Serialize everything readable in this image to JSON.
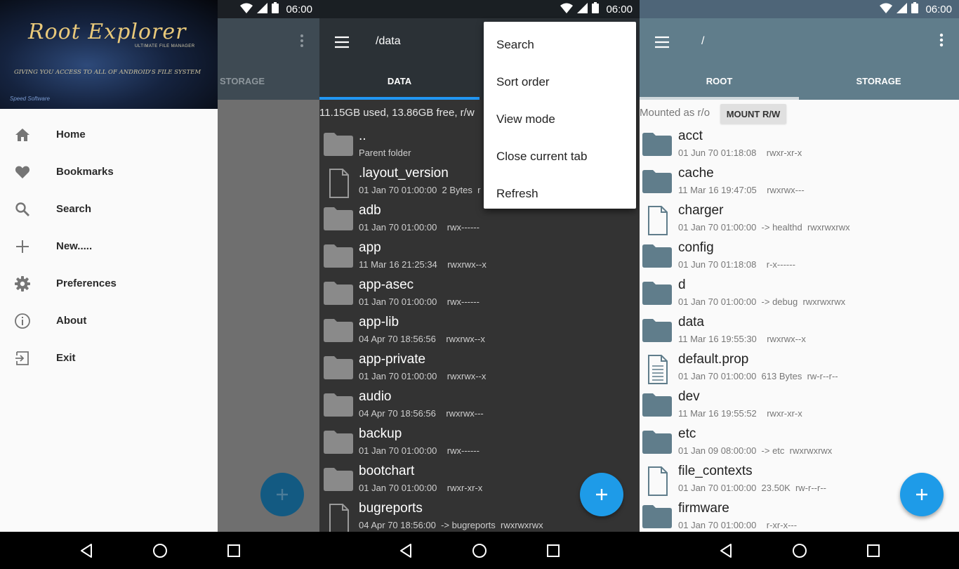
{
  "statusbar": {
    "time": "06:00"
  },
  "drawer": {
    "header": {
      "title": "Root Explorer",
      "subtitle": "ULTIMATE FILE MANAGER",
      "tagline": "GIVING YOU ACCESS TO ALL OF ANDROID'S FILE SYSTEM",
      "brand": "Speed Software"
    },
    "items": [
      {
        "label": "Home",
        "icon": "home-icon"
      },
      {
        "label": "Bookmarks",
        "icon": "heart-icon"
      },
      {
        "label": "Search",
        "icon": "search-icon"
      },
      {
        "label": "New.....",
        "icon": "plus-icon"
      },
      {
        "label": "Preferences",
        "icon": "gear-icon"
      },
      {
        "label": "About",
        "icon": "info-icon"
      },
      {
        "label": "Exit",
        "icon": "exit-icon"
      }
    ],
    "background_tab": "STORAGE"
  },
  "data_screen": {
    "path": "/data",
    "tab": "DATA",
    "info": "11.15GB used, 13.86GB free, r/w",
    "files": [
      {
        "name": "..",
        "meta": "Parent folder",
        "type": "folder"
      },
      {
        "name": ".layout_version",
        "meta": "01 Jan 70 01:00:00  2 Bytes  r",
        "type": "file"
      },
      {
        "name": "adb",
        "meta": "01 Jan 70 01:00:00    rwx------",
        "type": "folder"
      },
      {
        "name": "app",
        "meta": "11 Mar 16 21:25:34    rwxrwx--x",
        "type": "folder"
      },
      {
        "name": "app-asec",
        "meta": "01 Jan 70 01:00:00    rwx------",
        "type": "folder"
      },
      {
        "name": "app-lib",
        "meta": "04 Apr 70 18:56:56    rwxrwx--x",
        "type": "folder"
      },
      {
        "name": "app-private",
        "meta": "01 Jan 70 01:00:00    rwxrwx--x",
        "type": "folder"
      },
      {
        "name": "audio",
        "meta": "04 Apr 70 18:56:56    rwxrwx---",
        "type": "folder"
      },
      {
        "name": "backup",
        "meta": "01 Jan 70 01:00:00    rwx------",
        "type": "folder"
      },
      {
        "name": "bootchart",
        "meta": "01 Jan 70 01:00:00    rwxr-xr-x",
        "type": "folder"
      },
      {
        "name": "bugreports",
        "meta": "04 Apr 70 18:56:00  -> bugreports  rwxrwxrwx",
        "type": "file"
      }
    ],
    "menu": [
      "Search",
      "Sort order",
      "View mode",
      "Close current tab",
      "Refresh"
    ]
  },
  "root_screen": {
    "path": "/",
    "tabs": [
      "ROOT",
      "STORAGE"
    ],
    "mounted_text": "Mounted as r/o",
    "mount_button": "MOUNT R/W",
    "files": [
      {
        "name": "acct",
        "meta": "01 Jun 70 01:18:08    rwxr-xr-x",
        "type": "folder"
      },
      {
        "name": "cache",
        "meta": "11 Mar 16 19:47:05    rwxrwx---",
        "type": "folder"
      },
      {
        "name": "charger",
        "meta": "01 Jan 70 01:00:00  -> healthd  rwxrwxrwx",
        "type": "file"
      },
      {
        "name": "config",
        "meta": "01 Jun 70 01:18:08    r-x------",
        "type": "folder"
      },
      {
        "name": "d",
        "meta": "01 Jan 70 01:00:00  -> debug  rwxrwxrwx",
        "type": "folder"
      },
      {
        "name": "data",
        "meta": "11 Mar 16 19:55:30    rwxrwx--x",
        "type": "folder"
      },
      {
        "name": "default.prop",
        "meta": "01 Jan 70 01:00:00  613 Bytes  rw-r--r--",
        "type": "doc"
      },
      {
        "name": "dev",
        "meta": "11 Mar 16 19:55:52    rwxr-xr-x",
        "type": "folder"
      },
      {
        "name": "etc",
        "meta": "01 Jan 09 08:00:00  -> etc  rwxrwxrwx",
        "type": "folder"
      },
      {
        "name": "file_contexts",
        "meta": "01 Jan 70 01:00:00  23.50K  rw-r--r--",
        "type": "file"
      },
      {
        "name": "firmware",
        "meta": "01 Jan 70 01:00:00    r-xr-x---",
        "type": "folder"
      }
    ]
  },
  "colors": {
    "accent": "#1e9be8",
    "dark_toolbar": "#2b3136",
    "light_toolbar": "#607d8b",
    "folder_dark": "#8a8a8a",
    "folder_light": "#607d8b"
  }
}
